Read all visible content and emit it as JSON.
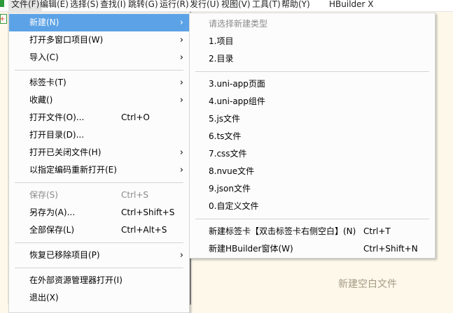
{
  "menubar": [
    "文件(F)",
    "编辑(E)",
    "选择(S)",
    "查找(I)",
    "跳转(G)",
    "运行(R)",
    "发行(U)",
    "视图(V)",
    "工具(T)",
    "帮助(Y)"
  ],
  "app_title": "HBuilder X",
  "file_menu": [
    {
      "label": "新建(N)",
      "submenu": true
    },
    {
      "label": "打开多窗口项目(W)",
      "submenu": true
    },
    {
      "label": "导入(C)",
      "submenu": true
    },
    {
      "label": "标签卡(T)",
      "submenu": true
    },
    {
      "label": "收藏()",
      "submenu": true
    },
    {
      "label": "打开文件(O)...",
      "shortcut": "Ctrl+O"
    },
    {
      "label": "打开目录(D)..."
    },
    {
      "label": "打开已关闭文件(H)",
      "submenu": true
    },
    {
      "label": "以指定编码重新打开(E)",
      "submenu": true
    },
    {
      "label": "保存(S)",
      "shortcut": "Ctrl+S",
      "disabled": true
    },
    {
      "label": "另存为(A)...",
      "shortcut": "Ctrl+Shift+S"
    },
    {
      "label": "全部保存(L)",
      "shortcut": "Ctrl+Alt+S"
    },
    {
      "label": "恢复已移除项目(P)",
      "submenu": true
    },
    {
      "label": "在外部资源管理器打开(I)"
    },
    {
      "label": "退出(X)"
    }
  ],
  "new_submenu": {
    "header": "请选择新建类型",
    "items": [
      {
        "label": "1.项目"
      },
      {
        "label": "2.目录"
      },
      {
        "label": "3.uni-app页面"
      },
      {
        "label": "4.uni-app组件"
      },
      {
        "label": "5.js文件"
      },
      {
        "label": "6.ts文件"
      },
      {
        "label": "7.css文件"
      },
      {
        "label": "8.nvue文件"
      },
      {
        "label": "9.json文件"
      },
      {
        "label": "0.自定义文件"
      },
      {
        "label": "新建标签卡【双击标签卡右侧空白】(N)",
        "shortcut": "Ctrl+T"
      },
      {
        "label": "新建HBuilder窗体(W)",
        "shortcut": "Ctrl+Shift+N"
      }
    ]
  },
  "editor_placeholder": "新建空白文件",
  "colors": {
    "highlight": "#5ca2e6",
    "background": "#fdf8ea"
  }
}
